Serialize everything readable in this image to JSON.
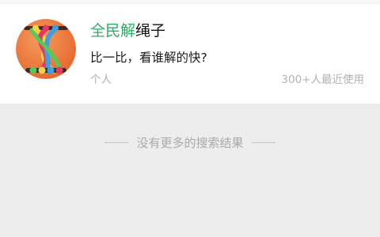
{
  "result": {
    "title_highlight": "全民解",
    "title_rest": "绳子",
    "description": "比一比，看谁解的快?",
    "type": "个人",
    "usage": "300+人最近使用",
    "avatar": "rope-puzzle-game-icon",
    "highlight_color": "#2aae67"
  },
  "footer": {
    "no_more_text": "没有更多的搜索结果"
  }
}
